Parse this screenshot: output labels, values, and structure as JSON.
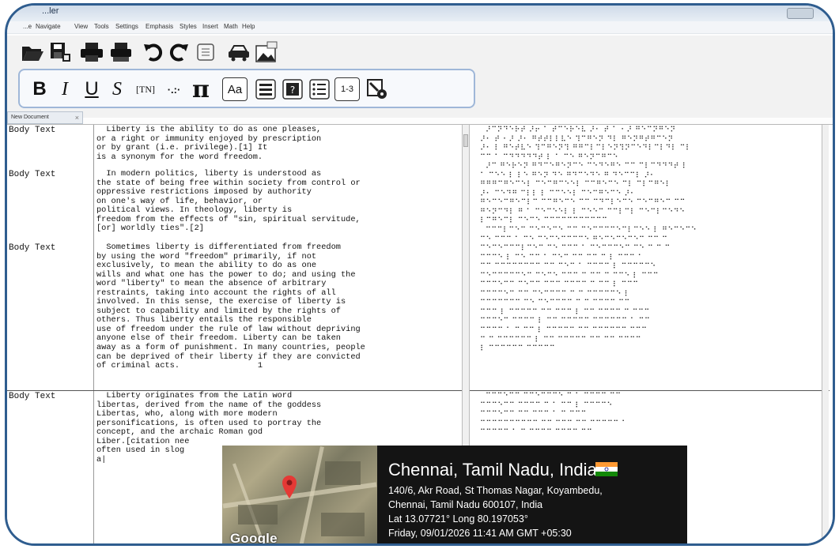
{
  "window": {
    "title": "...ler"
  },
  "menu": [
    "...e",
    "Navigate",
    "View",
    "Tools",
    "Settings",
    "Emphasis",
    "Styles",
    "Insert",
    "Math",
    "Help"
  ],
  "toolbar": {
    "row1_icons": [
      "open-folder-icon",
      "save-as-icon",
      "print-icon",
      "print-braille-icon",
      "undo-icon",
      "redo-icon",
      "embosser-icon",
      "car-icon",
      "image-icon"
    ],
    "row2": {
      "bold": "B",
      "italic": "I",
      "underline": "U",
      "script": "S",
      "tn": "[TN]",
      "dots": "·.:·",
      "pi": "π",
      "aa": "Aa",
      "list_num": "1-3"
    }
  },
  "document_tab": {
    "label": "New Document"
  },
  "editor": {
    "styles": [
      "Body Text",
      "Body Text",
      "Body Text",
      "Body Text"
    ],
    "para1": "  Liberty is the ability to do as one pleases,\nor a right or immunity enjoyed by prescription\nor by grant (i.e. privilege).[1] It\nis a synonym for the word freedom.",
    "para2": "  In modern politics, liberty is understood as\nthe state of being free within society from control or\noppressive restrictions imposed by authority\non one's way of life, behavior, or\npolitical views. In theology, liberty is\nfreedom from the effects of \"sin, spiritual servitude,\n[or] worldly ties\".[2]",
    "para3": "  Sometimes liberty is differentiated from freedom\nby using the word \"freedom\" primarily, if not\nexclusively, to mean the ability to do as one\nwills and what one has the power to do; and using the\nword \"liberty\" to mean the absence of arbitrary\nrestraints, taking into account the rights of all\ninvolved. In this sense, the exercise of liberty is\nsubject to capability and limited by the rights of\nothers. Thus liberty entails the responsible\nuse of freedom under the rule of law without depriving\nanyone else of their freedom. Liberty can be taken\naway as a form of punishment. In many countries, people\ncan be deprived of their liberty if they are convicted\nof criminal acts.                1",
    "para4": "  Liberty originates from the Latin word\nlibertas, derived from the name of the goddess\nLibertas, who, along with more modern\npersonifications, is often used to portray the\nconcept, and the archaic Roman god\nLiber.[citation nee\noften used in slog\na|"
  },
  "braille": {
    "block1": "  ⠜⠉⠝⠙⠑⠗⠞ ⠜⠖ ⠁ ⠞⠉⠑⠗⠑⠧ ⠜⠂ ⠞ ⠁ ⠂⠜ ⠛⠑⠉⠝⠛⠑⠝\n⠜⠂ ⠞ ⠂⠜ ⠜⠂ ⠛⠞⠞⠇⠇⠧⠑ ⠹⠉⠛⠑⠝ ⠙⠇ ⠛⠑⠝⠛⠞⠛⠉⠑⠝\n⠜⠂ ⠇ ⠛⠑⠞⠧⠑ ⠹⠉⠛⠑⠝⠹ ⠛⠛⠉⠇⠉⠇⠑⠝⠹⠝⠉⠑⠙⠇⠉⠇⠙⠇ ⠉⠇\n⠉⠉ ⠁ ⠉⠙⠙⠙⠙⠙⠞ ⠇ ⠁ ⠉⠑ ⠛⠑⠝⠉⠛⠉⠑",
    "block2": "  ⠜⠉ ⠛⠑⠗⠑⠝ ⠛⠙⠉⠑⠛⠑⠝⠉⠑ ⠉⠑⠙⠑⠛⠑ ⠉⠉ ⠉⠇⠉⠙⠙⠙⠞ ⠇\n⠁ ⠉⠑⠑ ⠇ ⠇⠑ ⠛⠑⠝ ⠙⠑ ⠛⠙⠉⠑⠙⠑ ⠛ ⠙⠑⠉⠉⠇ ⠜⠂\n⠛⠛⠛⠉⠛⠑⠉⠑⠇ ⠉⠑⠉⠛⠉⠑⠑⠇ ⠉⠉⠛⠑⠉⠑ ⠉⠇ ⠉⠇⠉⠛⠑⠇\n⠜⠂ ⠉⠑⠙⠛ ⠉⠇⠇ ⠇ ⠉⠉⠑⠑⠇ ⠉⠑⠉⠛⠑⠉⠑ ⠜⠂\n⠛⠑⠉⠑⠉⠛⠑⠉⠇⠉ ⠉⠉⠛⠑⠉⠑ ⠉⠉ ⠉⠙⠉⠇⠑⠉⠑ ⠉⠑⠉⠛⠑⠉ ⠉⠉\n⠛⠑⠝⠉⠙⠇ ⠛ ⠁ ⠉⠑⠉⠑⠑⠇ ⠇ ⠉⠑⠑⠉ ⠉⠉⠇⠉⠇ ⠉⠑⠉⠇⠉⠑⠙⠑\n⠇⠉⠛⠑⠉⠇ ⠉⠑⠉⠑ ⠉⠉⠉⠉⠉⠉⠉⠉⠉⠉⠉",
    "block3": "  ⠉⠉⠉⠇⠉⠑⠉ ⠉⠑⠉⠑⠉⠑ ⠉⠉ ⠉⠑⠉⠉⠉⠉⠑⠉⠇⠉⠑⠑ ⠇ ⠛⠑⠉⠑⠉⠑\n⠉⠑ ⠉⠉⠉ ⠁ ⠉⠑ ⠉⠑⠉⠑⠉⠉⠉⠉⠑ ⠛⠑⠉⠑⠉⠑⠉⠑⠉ ⠉⠉ ⠉\n⠉⠑⠉⠑⠉⠉⠉⠇⠉⠑⠉ ⠉⠑ ⠉⠉⠉ ⠁ ⠉⠑⠉⠉⠉⠑⠉ ⠉⠑ ⠉ ⠉ ⠉\n⠉⠉⠉⠑ ⠇ ⠉⠑ ⠉⠉ ⠁ ⠉⠑⠉ ⠉⠉ ⠉⠉ ⠉ ⠇ ⠉⠉⠉ ⠁\n⠉⠉ ⠉⠉⠉⠉⠉⠉⠉⠉ ⠉⠉ ⠉⠑⠉ ⠁ ⠉⠉⠉⠉ ⠇ ⠉⠉⠉⠉⠉⠑\n⠉⠑⠉⠉⠉⠉⠉⠑⠉ ⠉⠑⠉⠑ ⠉⠉⠉ ⠉ ⠉⠉ ⠉ ⠉⠉⠑ ⠇ ⠉⠉⠉\n⠉⠉⠉⠑⠉⠉ ⠉⠑⠉⠉ ⠉⠉⠉ ⠉⠉⠉⠉ ⠉ ⠉⠉ ⠇ ⠉⠉⠉\n⠉⠉⠉⠉⠑⠉ ⠉⠉ ⠉⠑⠉⠉⠉⠉ ⠉ ⠉ ⠉⠉⠉⠉⠉⠑ ⠇\n⠉⠉⠉⠉⠉⠉⠉ ⠉⠑ ⠉⠑⠉⠉⠉⠉ ⠉ ⠉ ⠉⠉⠉⠉ ⠉⠉\n⠉⠉⠉ ⠇ ⠉⠉⠉⠉⠉ ⠉⠉ ⠉⠉⠉ ⠇ ⠉⠉ ⠉⠉⠉⠉ ⠉ ⠉⠉⠉\n⠉⠉⠉⠑⠉ ⠉⠉⠉⠉ ⠇ ⠉⠉ ⠉⠉⠉⠉⠉ ⠉⠉⠉⠉⠉⠉ ⠁ ⠉⠉\n⠉⠉⠉⠉ ⠁ ⠉ ⠉⠉ ⠇ ⠉⠉⠉⠉⠉ ⠉⠉ ⠉⠉⠉⠉⠉⠉ ⠉⠉⠉\n⠉ ⠉ ⠉⠉⠉⠉⠉⠉ ⠇ ⠉⠉ ⠉⠉⠉⠉⠉ ⠉⠉ ⠉⠉ ⠉⠉⠉⠉\n⠇ ⠉⠉⠉⠉⠉⠉ ⠉⠉⠉⠉⠉",
    "block4": "  ⠉⠉⠉⠑⠉⠉ ⠉⠉⠑⠉⠉⠉⠑ ⠉ ⠁ ⠉⠉⠉⠉ ⠉⠉\n⠉⠉⠉⠑⠉⠉ ⠉⠉⠉⠉ ⠉ ⠁ ⠉⠉ ⠇ ⠉⠉⠉⠉⠑\n⠉⠉⠉⠑⠉⠉ ⠉⠉ ⠉⠉⠉ ⠁ ⠉ ⠉⠉⠉\n⠉⠉⠉⠉⠉⠉⠉⠉⠉⠉ ⠉⠉ ⠉⠉⠉ ⠉⠉ ⠉⠉⠉⠉⠉ ⠁\n⠉⠉⠉⠉⠉ ⠁ ⠉ ⠉⠉⠉⠉ ⠉⠉⠉⠉ ⠉⠉"
  },
  "geotag": {
    "city": "Chennai, Tamil Nadu, India",
    "address_line1": "140/6, Akr Road, St Thomas Nagar, Koyambedu,",
    "address_line2": "Chennai, Tamil Nadu 600107, India",
    "coords": "Lat 13.07721° Long 80.197053°",
    "datetime": "Friday, 09/01/2026 11:41 AM GMT +05:30",
    "map_brand": "Google",
    "colors": {
      "flag_saffron": "#ff9933",
      "flag_green": "#138808",
      "pin": "#e53935"
    }
  }
}
